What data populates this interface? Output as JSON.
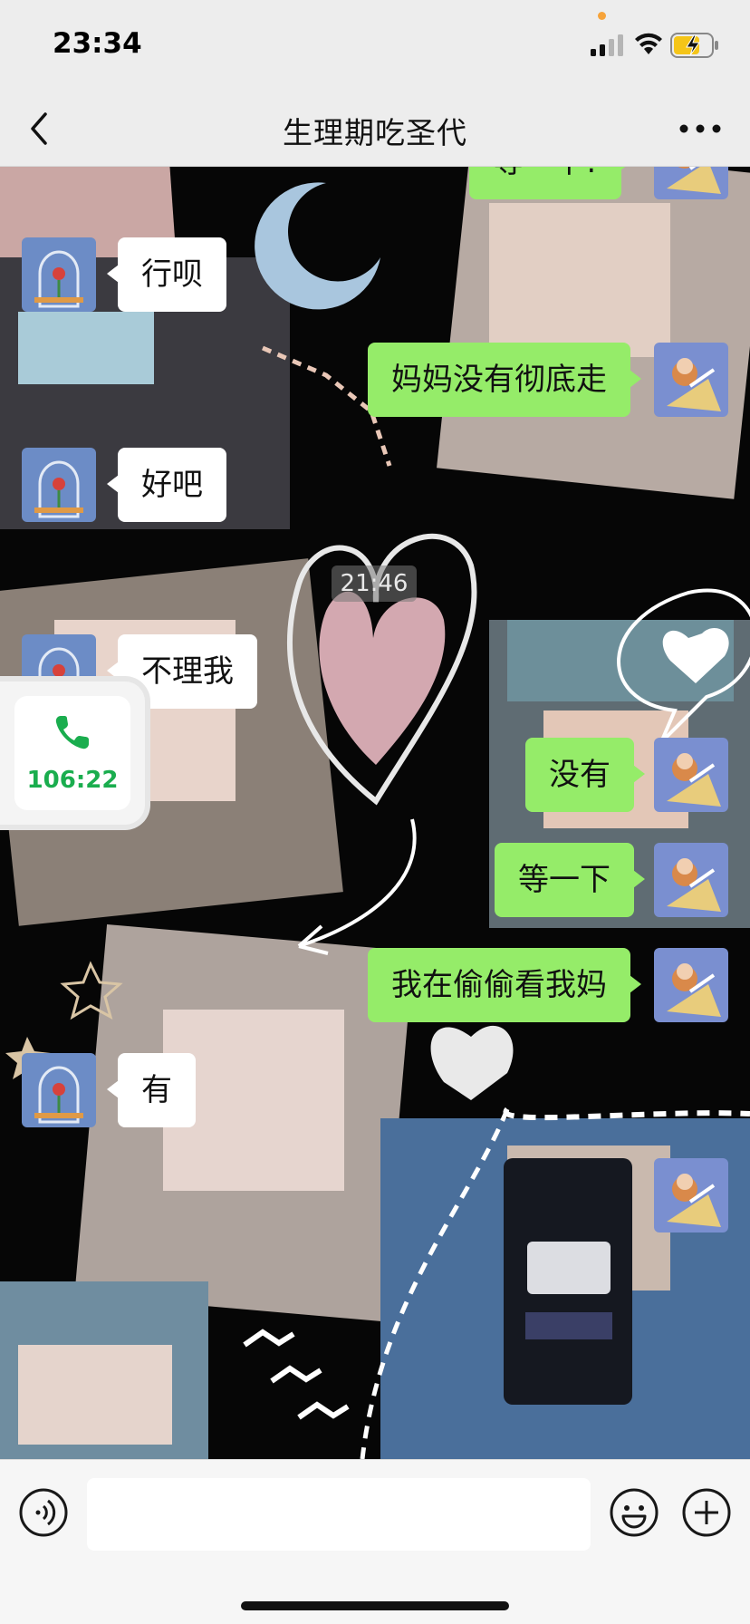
{
  "status_bar": {
    "time": "23:34"
  },
  "header": {
    "title": "生理期吃圣代"
  },
  "messages": [
    {
      "side": "out",
      "text": "等一下!"
    },
    {
      "side": "in",
      "text": "行呗"
    },
    {
      "side": "out",
      "text": "妈妈没有彻底走"
    },
    {
      "side": "in",
      "text": "好吧"
    },
    {
      "side": "in",
      "text": "不理我"
    },
    {
      "side": "out",
      "text": "没有"
    },
    {
      "side": "out",
      "text": "等一下"
    },
    {
      "side": "out",
      "text": "我在偷偷看我妈"
    },
    {
      "side": "in",
      "text": "有"
    }
  ],
  "timestamp": "21:46",
  "call_widget": {
    "duration": "106:22"
  },
  "input": {
    "value": ""
  },
  "colors": {
    "outgoing_bubble": "#95ec69",
    "incoming_bubble": "#ffffff",
    "call_green": "#1aad4e",
    "bar_background": "#ededed"
  },
  "icons": [
    "back-icon",
    "more-icon",
    "signal-icon",
    "wifi-icon",
    "battery-icon",
    "phone-icon",
    "voice-icon",
    "emoji-icon",
    "plus-icon"
  ]
}
